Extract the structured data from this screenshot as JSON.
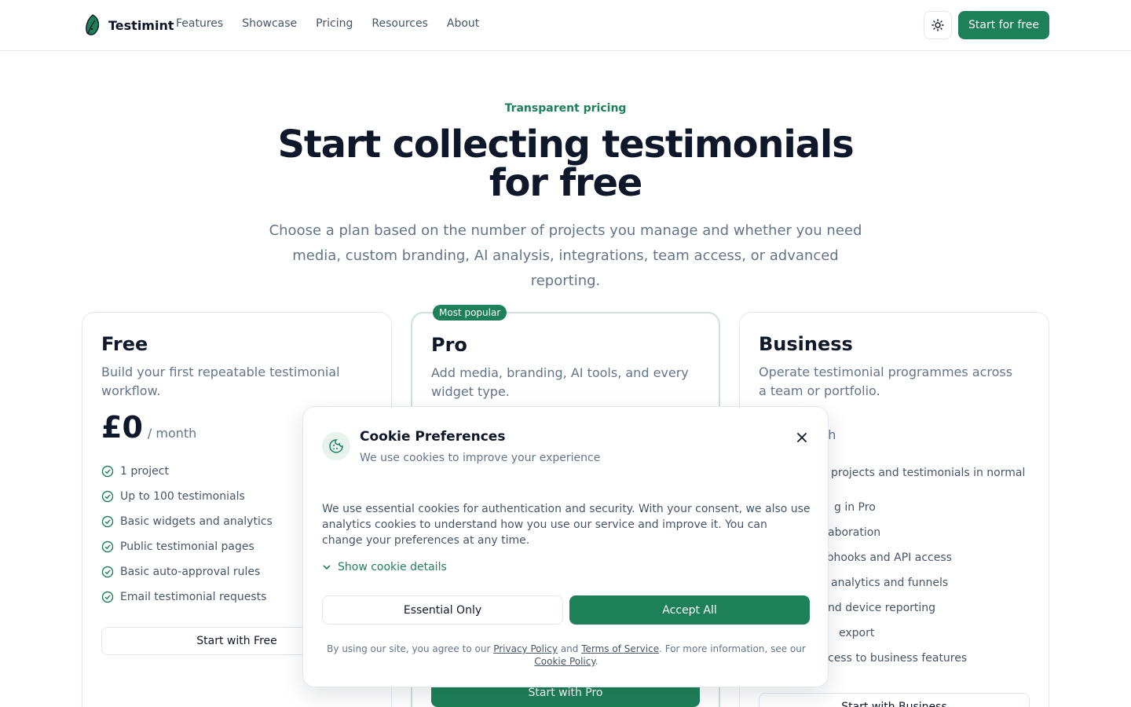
{
  "brand": {
    "name": "Testimint",
    "accent": "#1e8059"
  },
  "nav": {
    "items": [
      "Features",
      "Showcase",
      "Pricing",
      "Resources",
      "About"
    ],
    "cta": "Start for free",
    "theme_icon": "sun-icon"
  },
  "hero": {
    "eyebrow": "Transparent pricing",
    "title": "Start collecting testimonials for free",
    "subtitle": "Choose a plan based on the number of projects you manage and whether you need media, custom branding, AI analysis, integrations, team access, or advanced reporting."
  },
  "plans": {
    "free": {
      "name": "Free",
      "description": "Build your first repeatable testimonial workflow.",
      "price": "£0",
      "period": "/ month",
      "features": [
        "1 project",
        "Up to 100 testimonials",
        "Basic widgets and analytics",
        "Public testimonial pages",
        "Basic auto-approval rules",
        "Email testimonial requests"
      ],
      "button": "Start with Free"
    },
    "pro": {
      "badge": "Most popular",
      "name": "Pro",
      "description": "Add media, branding, AI tools, and every widget type.",
      "button": "Start with Pro"
    },
    "business": {
      "name": "Business",
      "description": "Operate testimonial programmes across a team or portfolio.",
      "period": "onth",
      "features": [
        "projects and testimonials in normal",
        "g in Pro",
        "aboration",
        "ebhooks and API access",
        "analytics and funnels",
        "nd device reporting",
        "export",
        "cess to business features"
      ],
      "button": "Start with Business"
    }
  },
  "cookie_modal": {
    "title": "Cookie Preferences",
    "subtitle": "We use cookies to improve your experience",
    "body": "We use essential cookies for authentication and security. With your consent, we also use analytics cookies to understand how you use our service and improve it. You can change your preferences at any time.",
    "details_toggle": "Show cookie details",
    "essential_button": "Essential Only",
    "accept_button": "Accept All",
    "footer_prefix": "By using our site, you agree to our",
    "privacy_link": "Privacy Policy",
    "and": "and",
    "terms_link": "Terms of Service",
    "footer_mid": ". For more information, see our",
    "cookie_link": "Cookie Policy",
    "footer_end": "."
  }
}
